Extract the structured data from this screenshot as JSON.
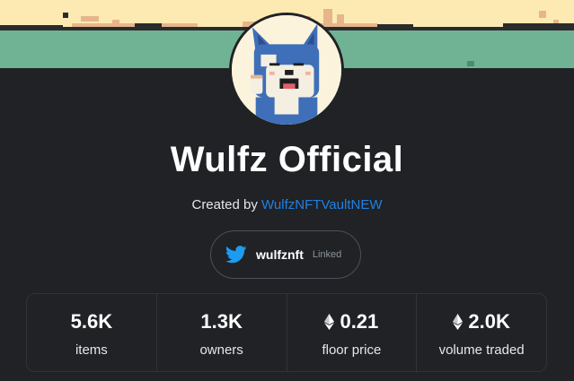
{
  "collection": {
    "name": "Wulfz Official",
    "created_prefix": "Created by",
    "creator": "WulfzNFTVaultNEW"
  },
  "banner": {
    "sky_color": "#fdeab3",
    "ground_color": "#6fb394"
  },
  "social": {
    "icon": "twitter-icon",
    "handle": "wulfznft",
    "status": "Linked"
  },
  "stats": [
    {
      "value": "5.6K",
      "label": "items",
      "eth": false
    },
    {
      "value": "1.3K",
      "label": "owners",
      "eth": false
    },
    {
      "value": "0.21",
      "label": "floor price",
      "eth": true
    },
    {
      "value": "2.0K",
      "label": "volume traded",
      "eth": true
    }
  ],
  "colors": {
    "background": "#202225",
    "link": "#2081e2",
    "twitter": "#1d9bf0",
    "border": "#303339"
  }
}
